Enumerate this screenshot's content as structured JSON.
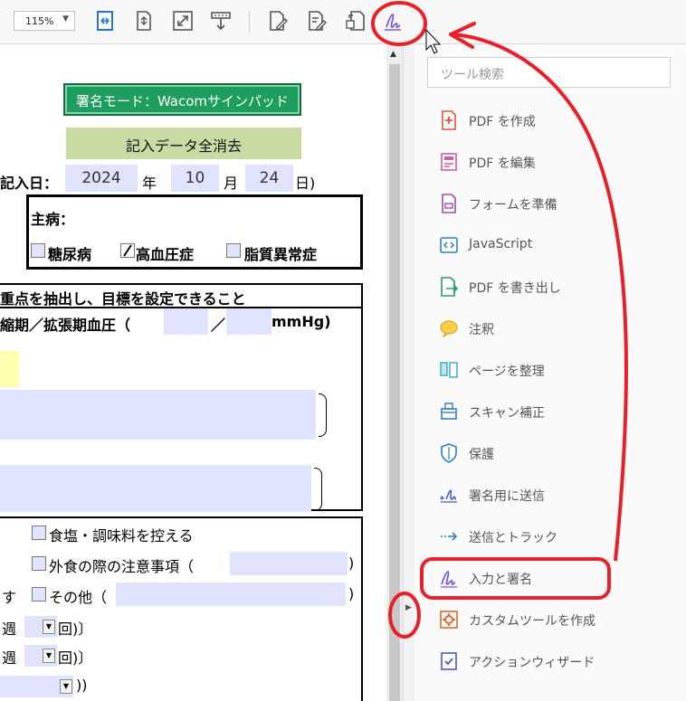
{
  "toolbar": {
    "zoom_value": "115%",
    "icons": [
      "fit-page-icon",
      "fit-width-icon",
      "fullscreen-icon",
      "read-mode-icon",
      "edit-form-icon",
      "edit-text-icon",
      "export-icon",
      "fill-sign-icon"
    ]
  },
  "document": {
    "sign_mode_button": "署名モード：Wacomサインパッド",
    "clear_all_button": "記入データ全消去",
    "entry_date_label": "記入日：",
    "year_value": "2024",
    "year_label": "年",
    "month_value": "10",
    "month_label": "月",
    "day_value": "24",
    "day_label": "日)",
    "main_disease_label": "主病：",
    "diabetes_label": "糖尿病",
    "hypertension_label": "高血圧症",
    "dyslipidemia_label": "脂質異常症",
    "goal_heading": "重点を抽出し、目標を設定できること",
    "bp_label": "縮期／拡張期血圧（",
    "bp_slash": "／",
    "bp_unit": "mmHg)",
    "salt_label": "食塩・調味料を控える",
    "eating_out_label": "外食の際の注意事項（",
    "close_paren": ")",
    "other_prefix": "す",
    "other_label": "その他（",
    "week_label_1": "週",
    "times_label_1": "回)〕",
    "week_label_2": "週",
    "times_label_2": "回)〕",
    "last_close": "))"
  },
  "panel": {
    "search_placeholder": "ツール検索",
    "tools": [
      {
        "label": "PDF を作成",
        "icon": "create-pdf-icon"
      },
      {
        "label": "PDF を編集",
        "icon": "edit-pdf-icon"
      },
      {
        "label": "フォームを準備",
        "icon": "prepare-form-icon"
      },
      {
        "label": "JavaScript",
        "icon": "javascript-icon"
      },
      {
        "label": "PDF を書き出し",
        "icon": "export-pdf-icon"
      },
      {
        "label": "注釈",
        "icon": "comment-icon"
      },
      {
        "label": "ページを整理",
        "icon": "organize-pages-icon"
      },
      {
        "label": "スキャン補正",
        "icon": "scan-enhance-icon"
      },
      {
        "label": "保護",
        "icon": "protect-icon"
      },
      {
        "label": "署名用に送信",
        "icon": "send-for-signature-icon"
      },
      {
        "label": "送信とトラック",
        "icon": "send-track-icon"
      },
      {
        "label": "入力と署名",
        "icon": "fill-sign-icon"
      },
      {
        "label": "カスタムツールを作成",
        "icon": "custom-tool-icon"
      },
      {
        "label": "アクションウィザード",
        "icon": "action-wizard-icon"
      }
    ]
  },
  "colors": {
    "field_bg": "#dfe3fb",
    "annotation_red": "#e8202a",
    "sign_button_green": "#1e9e5e",
    "clear_button_green": "#c9dba3"
  }
}
